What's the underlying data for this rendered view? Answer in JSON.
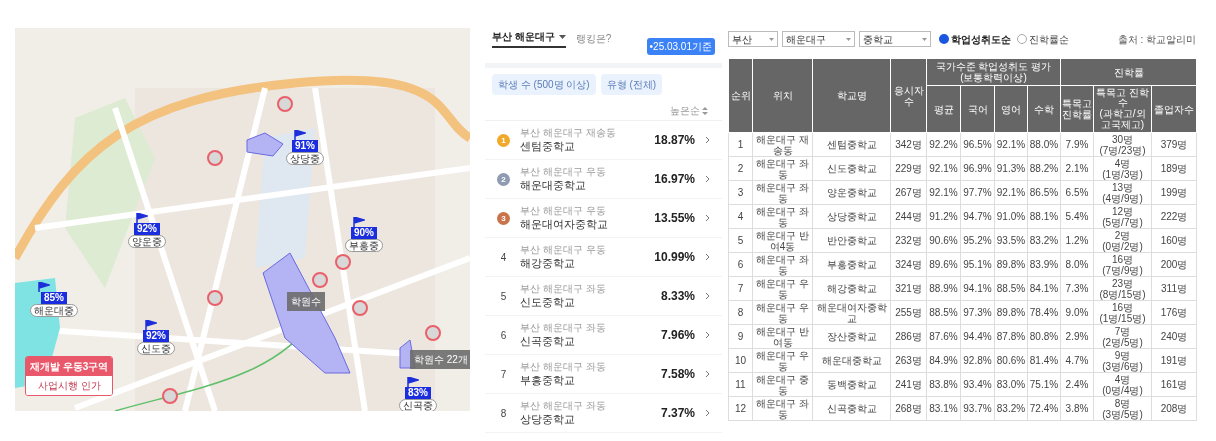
{
  "map": {
    "school_markers": [
      {
        "rate": "91%",
        "name": "상당중"
      },
      {
        "rate": "92%",
        "name": "양운중"
      },
      {
        "rate": "90%",
        "name": "부흥중"
      },
      {
        "rate": "85%",
        "name": "해운대중"
      },
      {
        "rate": "92%",
        "name": "신도중"
      },
      {
        "rate": "83%",
        "name": "신곡중"
      }
    ],
    "academy_labels": [
      "학원수",
      "학원수 22개"
    ],
    "notice": {
      "title": "재개발 우동3구역",
      "subtitle": "사업시행 인가"
    }
  },
  "ranking": {
    "region": "부산 해운대구",
    "title": "랭킹은?",
    "date_badge": "•25.03.01기준",
    "filters": [
      "학생 수 (500명 이상)",
      "유형 (전체)"
    ],
    "sort": "높은순",
    "items": [
      {
        "kind": "medal",
        "color": "#f0a92a",
        "rank": "1",
        "location": "부산 해운대구 재송동",
        "name": "센텀중학교",
        "rate": "18.87%"
      },
      {
        "kind": "medal",
        "color": "#8f9bb0",
        "rank": "2",
        "location": "부산 해운대구 우동",
        "name": "해운대중학교",
        "rate": "16.97%"
      },
      {
        "kind": "medal",
        "color": "#c8734a",
        "rank": "3",
        "location": "부산 해운대구 우동",
        "name": "해운대여자중학교",
        "rate": "13.55%"
      },
      {
        "kind": "number",
        "rank": "4",
        "location": "부산 해운대구 우동",
        "name": "해강중학교",
        "rate": "10.99%"
      },
      {
        "kind": "number",
        "rank": "5",
        "location": "부산 해운대구 좌동",
        "name": "신도중학교",
        "rate": "8.33%"
      },
      {
        "kind": "number",
        "rank": "6",
        "location": "부산 해운대구 좌동",
        "name": "신곡중학교",
        "rate": "7.96%"
      },
      {
        "kind": "number",
        "rank": "7",
        "location": "부산 해운대구 좌동",
        "name": "부흥중학교",
        "rate": "7.58%"
      },
      {
        "kind": "number",
        "rank": "8",
        "location": "부산 해운대구 좌동",
        "name": "상당중학교",
        "rate": "7.37%"
      }
    ]
  },
  "table": {
    "selects": [
      "부산",
      "해운대구",
      "중학교"
    ],
    "radios": [
      {
        "label": "학업성취도순",
        "selected": true
      },
      {
        "label": "진학률순",
        "selected": false
      }
    ],
    "source": "출처 : 학교알리미",
    "header": {
      "rank": "순위",
      "location": "위치",
      "school": "학교명",
      "takers": "응시자수",
      "group_1": "국가수준 학업성취도 평가 (보통학력이상)",
      "group_1_columns": [
        "평균",
        "국어",
        "영어",
        "수학"
      ],
      "group_2": "진학률",
      "special_rate": "특목고 진학률",
      "special_count": "특목고 진학수",
      "special_count_note": "(과학고/외고국제고)",
      "graduates": "졸업자수"
    },
    "rows": [
      {
        "rank": "1",
        "location": "해운대구 재송동",
        "school": "센텀중학교",
        "takers": "342명",
        "scores": [
          "92.2%",
          "96.5%",
          "92.1%",
          "88.0%"
        ],
        "special_rate": "7.9%",
        "special_count": "30명",
        "special_detail": "(7명/23명)",
        "graduates": "379명"
      },
      {
        "rank": "2",
        "location": "해운대구 좌동",
        "school": "신도중학교",
        "takers": "229명",
        "scores": [
          "92.1%",
          "96.9%",
          "91.3%",
          "88.2%"
        ],
        "special_rate": "2.1%",
        "special_count": "4명",
        "special_detail": "(1명/3명)",
        "graduates": "189명"
      },
      {
        "rank": "3",
        "location": "해운대구 좌동",
        "school": "양운중학교",
        "takers": "267명",
        "scores": [
          "92.1%",
          "97.7%",
          "92.1%",
          "86.5%"
        ],
        "special_rate": "6.5%",
        "special_count": "13명",
        "special_detail": "(4명/9명)",
        "graduates": "199명"
      },
      {
        "rank": "4",
        "location": "해운대구 좌동",
        "school": "상당중학교",
        "takers": "244명",
        "scores": [
          "91.2%",
          "94.7%",
          "91.0%",
          "88.1%"
        ],
        "special_rate": "5.4%",
        "special_count": "12명",
        "special_detail": "(5명/7명)",
        "graduates": "222명"
      },
      {
        "rank": "5",
        "location": "해운대구 반여4동",
        "school": "반안중학교",
        "takers": "232명",
        "scores": [
          "90.6%",
          "95.2%",
          "93.5%",
          "83.2%"
        ],
        "special_rate": "1.2%",
        "special_count": "2명",
        "special_detail": "(0명/2명)",
        "graduates": "160명"
      },
      {
        "rank": "6",
        "location": "해운대구 좌동",
        "school": "부흥중학교",
        "takers": "324명",
        "scores": [
          "89.6%",
          "95.1%",
          "89.8%",
          "83.9%"
        ],
        "special_rate": "8.0%",
        "special_count": "16명",
        "special_detail": "(7명/9명)",
        "graduates": "200명"
      },
      {
        "rank": "7",
        "location": "해운대구 우동",
        "school": "해강중학교",
        "takers": "321명",
        "scores": [
          "88.9%",
          "94.1%",
          "88.5%",
          "84.1%"
        ],
        "special_rate": "7.3%",
        "special_count": "23명",
        "special_detail": "(8명/15명)",
        "graduates": "311명"
      },
      {
        "rank": "8",
        "location": "해운대구 우동",
        "school": "해운대여자중학교",
        "takers": "255명",
        "scores": [
          "88.5%",
          "97.3%",
          "89.8%",
          "78.4%"
        ],
        "special_rate": "9.0%",
        "special_count": "16명",
        "special_detail": "(1명/15명)",
        "graduates": "176명"
      },
      {
        "rank": "9",
        "location": "해운대구 반여동",
        "school": "장산중학교",
        "takers": "286명",
        "scores": [
          "87.6%",
          "94.4%",
          "87.8%",
          "80.8%"
        ],
        "special_rate": "2.9%",
        "special_count": "7명",
        "special_detail": "(2명/5명)",
        "graduates": "240명"
      },
      {
        "rank": "10",
        "location": "해운대구 우동",
        "school": "해운대중학교",
        "takers": "263명",
        "scores": [
          "84.9%",
          "92.8%",
          "80.6%",
          "81.4%"
        ],
        "special_rate": "4.7%",
        "special_count": "9명",
        "special_detail": "(3명/6명)",
        "graduates": "191명"
      },
      {
        "rank": "11",
        "location": "해운대구 중동",
        "school": "동백중학교",
        "takers": "241명",
        "scores": [
          "83.8%",
          "93.4%",
          "83.0%",
          "75.1%"
        ],
        "special_rate": "2.4%",
        "special_count": "4명",
        "special_detail": "(0명/4명)",
        "graduates": "161명"
      },
      {
        "rank": "12",
        "location": "해운대구 좌동",
        "school": "신곡중학교",
        "takers": "268명",
        "scores": [
          "83.1%",
          "93.7%",
          "83.2%",
          "72.4%"
        ],
        "special_rate": "3.8%",
        "special_count": "8명",
        "special_detail": "(3명/5명)",
        "graduates": "208명"
      }
    ]
  }
}
